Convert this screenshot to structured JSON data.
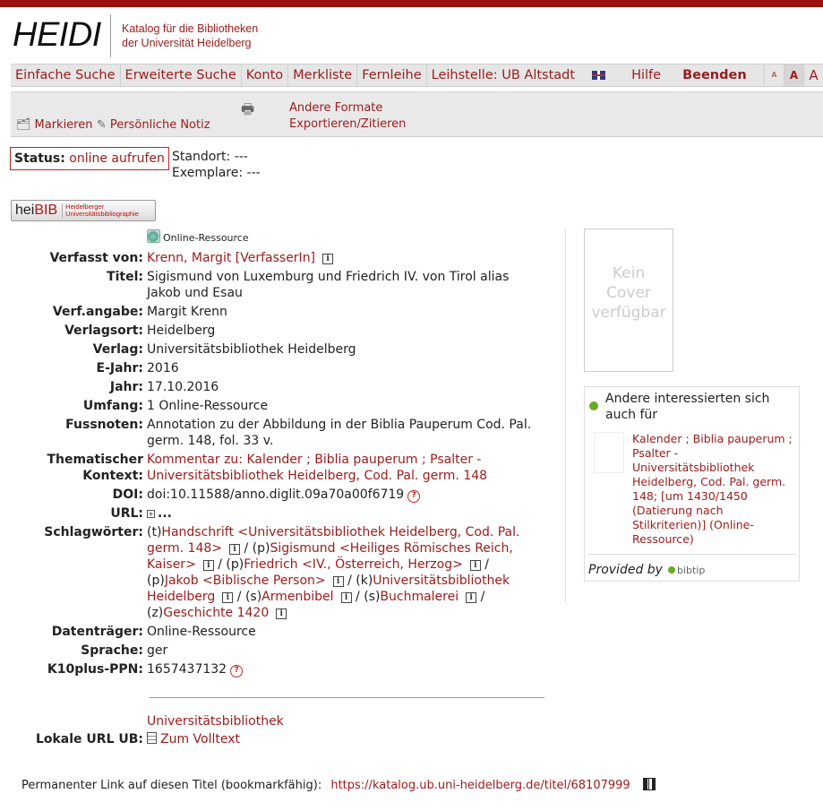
{
  "header": {
    "logo": "HEIDI",
    "tagline_line1": "Katalog für die Bibliotheken",
    "tagline_line2": "der Universität Heidelberg"
  },
  "nav": {
    "items": [
      "Einfache Suche",
      "Erweiterte Suche",
      "Konto",
      "Merkliste",
      "Fernleihe",
      "Leihstelle: UB Altstadt"
    ],
    "help": "Hilfe",
    "logout": "Beenden",
    "font_small": "A",
    "font_medium": "A",
    "font_large": "A"
  },
  "toolbar": {
    "mark": "Markieren",
    "note": "Persönliche Notiz",
    "other_formats": "Andere Formate",
    "export": "Exportieren/Zitieren"
  },
  "status": {
    "label": "Status:",
    "value": "online aufrufen",
    "standort": "Standort: ---",
    "exemplare": "Exemplare: ---"
  },
  "heibib": {
    "prefix": "hei",
    "main": "BIB",
    "sub1": "Heidelberger",
    "sub2": "Universitätsbibliographie"
  },
  "record": {
    "resource_type": "Online-Ressource",
    "author_label": "Verfasst von:",
    "author": "Krenn, Margit [VerfasserIn]",
    "title_label": "Titel:",
    "title": "Sigismund von Luxemburg und Friedrich IV. von Tirol alias Jakob und Esau",
    "verfangabe_label": "Verf.angabe:",
    "verfangabe": "Margit Krenn",
    "verlagsort_label": "Verlagsort:",
    "verlagsort": "Heidelberg",
    "verlag_label": "Verlag:",
    "verlag": "Universitätsbibliothek Heidelberg",
    "ejahr_label": "E-Jahr:",
    "ejahr": "2016",
    "jahr_label": "Jahr:",
    "jahr": "17.10.2016",
    "umfang_label": "Umfang:",
    "umfang": "1 Online-Ressource",
    "fussnoten_label": "Fussnoten:",
    "fussnoten": "Annotation zu der Abbildung in der Biblia Pauperum Cod. Pal. germ. 148, fol. 33 v.",
    "kontext_label1": "Thematischer",
    "kontext_label2": "Kontext:",
    "kontext": "Kommentar zu: Kalender ; Biblia pauperum ; Psalter - Universitätsbibliothek Heidelberg, Cod. Pal. germ. 148",
    "doi_label": "DOI:",
    "doi": "doi:10.11588/anno.diglit.09a70a00f6719",
    "url_label": "URL:",
    "url_more": "...",
    "schlag_label": "Schlagwörter:",
    "schlag": [
      {
        "prefix": "(t)",
        "text": "Handschrift <Universitätsbibliothek Heidelberg, Cod. Pal. germ. 148>"
      },
      {
        "prefix": "(p)",
        "text": "Sigismund <Heiliges Römisches Reich, Kaiser>"
      },
      {
        "prefix": "(p)",
        "text": "Friedrich <IV., Österreich, Herzog>"
      },
      {
        "prefix": "(p)",
        "text": "Jakob <Biblische Person>"
      },
      {
        "prefix": "(k)",
        "text": "Universitätsbibliothek Heidelberg"
      },
      {
        "prefix": "(s)",
        "text": "Armenbibel"
      },
      {
        "prefix": "(s)",
        "text": "Buchmalerei"
      },
      {
        "prefix": "(z)",
        "text": "Geschichte 1420"
      }
    ],
    "separator": "/",
    "info_glyph": "i",
    "help_glyph": "?",
    "plus_glyph": "+",
    "datentraeger_label": "Datenträger:",
    "datentraeger": "Online-Ressource",
    "sprache_label": "Sprache:",
    "sprache": "ger",
    "ppn_label": "K10plus-PPN:",
    "ppn": "1657437132",
    "lokal_org": "Universitätsbibliothek",
    "lokal_label": "Lokale URL UB:",
    "lokal_link": "Zum Volltext"
  },
  "cover": {
    "line1": "Kein",
    "line2": "Cover",
    "line3": "verfügbar"
  },
  "related": {
    "heading": "Andere interessierten sich auch für",
    "item": "Kalender ; Biblia pauperum ; Psalter - Universitätsbibliothek Heidelberg, Cod. Pal. germ. 148; [um 1430/1450 (Datierung nach Stilkriterien)] (Online-Ressource)",
    "provided_by": "Provided by",
    "provider": "bibtip"
  },
  "footer": {
    "permalink_label": "Permanenter Link auf diesen Titel (bookmarkfähig):",
    "permalink_url": "https://katalog.ub.uni-heidelberg.de/titel/68107999"
  },
  "colors": {
    "brand_red": "#9a1b1b",
    "topbar": "#9a0f0f",
    "nav_bg": "#e6e6e6"
  }
}
